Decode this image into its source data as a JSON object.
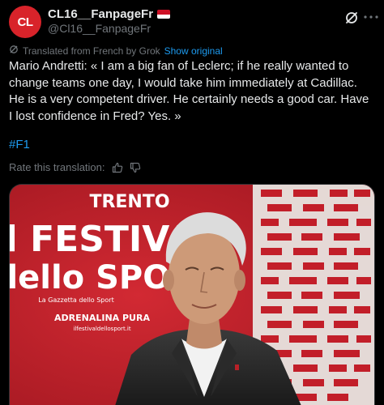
{
  "author": {
    "avatar_text": "CL",
    "display_name": "CL16__FanpageFr",
    "handle": "@Cl16__FanpageFr"
  },
  "translation_bar": {
    "text": "Translated from French by Grok",
    "show_original": "Show original"
  },
  "post": {
    "text": "Mario Andretti: « I am a big fan of Leclerc; if he really wanted to change teams one day, I would take him immediately at Cadillac. He is a very competent driver. He certainly needs a good car. Have I lost confidence in Fred? Yes. »",
    "hashtag": "#F1"
  },
  "rate": {
    "label": "Rate this translation:"
  },
  "media": {
    "backdrop": {
      "line1": "TRENTO",
      "line2": "il FESTIVAL",
      "line3": "dello SPORT",
      "sponsor": "La Gazzetta dello Sport",
      "tagline": "ADRENALINA PURA",
      "site": "ilfestivaldellosport.it"
    }
  },
  "colors": {
    "brand_red": "#d8232a",
    "link_blue": "#1d9bf0",
    "muted": "#71767b",
    "backdrop_red": "#c41f2a"
  },
  "icons": {
    "grok": "grok-icon",
    "more": "more-options-icon",
    "translate": "translate-icon",
    "thumbs_up": "thumbs-up-icon",
    "thumbs_down": "thumbs-down-icon"
  }
}
